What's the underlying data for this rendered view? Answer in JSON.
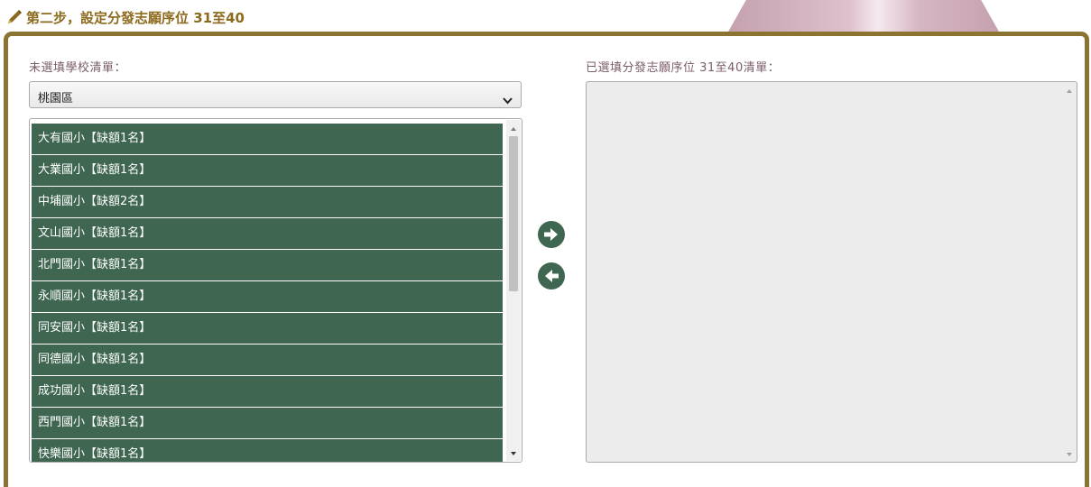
{
  "header": {
    "step_title": "第二步，設定分發志願序位 31至40",
    "edit_icon": "pencil-icon"
  },
  "left": {
    "label": "未選填學校清單：",
    "district_select": {
      "selected": "桃園區",
      "icon": "chevron-down-icon"
    },
    "schools": [
      "大有國小【缺額1名】",
      "大業國小【缺額1名】",
      "中埔國小【缺額2名】",
      "文山國小【缺額1名】",
      "北門國小【缺額1名】",
      "永順國小【缺額1名】",
      "同安國小【缺額1名】",
      "同德國小【缺額1名】",
      "成功國小【缺額1名】",
      "西門國小【缺額1名】",
      "快樂國小【缺額1名】"
    ]
  },
  "actions": {
    "add_icon": "arrow-right-circle-icon",
    "remove_icon": "arrow-left-circle-icon",
    "color": "#3e6650"
  },
  "right": {
    "label": "已選填分發志願序位 31至40清單："
  },
  "colors": {
    "frame": "#8b7332",
    "title": "#8c6a1d",
    "list_item_bg": "#3e6650",
    "selected_bg": "#ececec"
  }
}
